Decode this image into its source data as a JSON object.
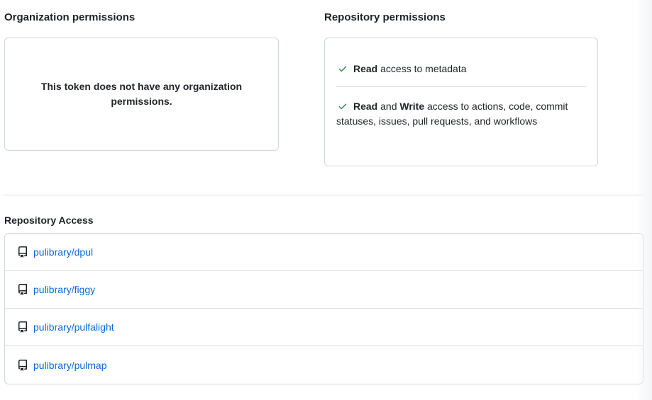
{
  "org_permissions": {
    "title": "Organization permissions",
    "empty_message": "This token does not have any organization permissions."
  },
  "repo_permissions": {
    "title": "Repository permissions",
    "items": [
      {
        "icon": "check-icon",
        "read": "Read",
        "rest": " access to metadata"
      },
      {
        "icon": "check-icon",
        "read": "Read",
        "and": " and ",
        "write": "Write",
        "rest": " access to actions, code, commit statuses, issues, pull requests, and workflows"
      }
    ],
    "check_color": "#1a7f37"
  },
  "repository_access": {
    "title": "Repository Access",
    "repos": [
      {
        "icon": "repo-icon",
        "name": "pulibrary/dpul"
      },
      {
        "icon": "repo-icon",
        "name": "pulibrary/figgy"
      },
      {
        "icon": "repo-icon",
        "name": "pulibrary/pulfalight"
      },
      {
        "icon": "repo-icon",
        "name": "pulibrary/pulmap"
      }
    ],
    "link_color": "#0969da"
  }
}
